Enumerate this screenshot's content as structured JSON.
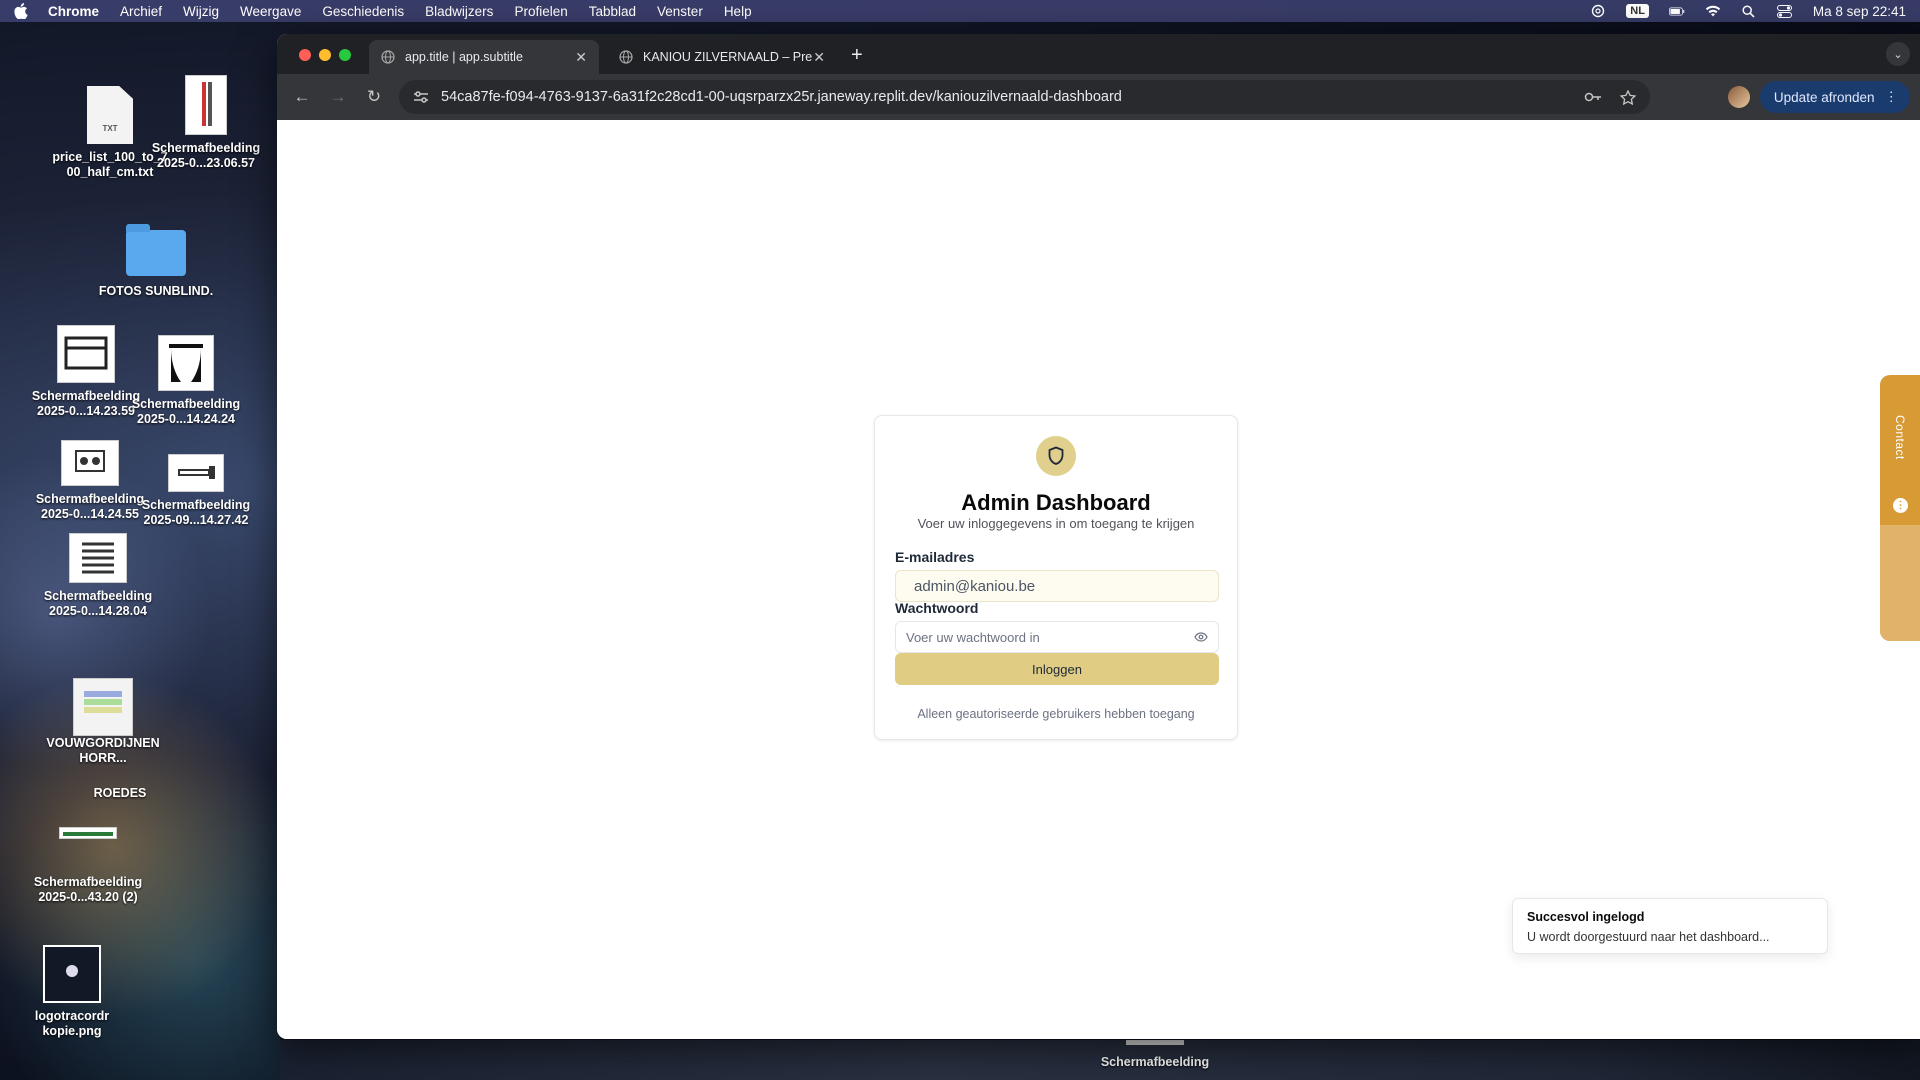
{
  "menubar": {
    "app_name": "Chrome",
    "items": [
      "Archief",
      "Wijzig",
      "Weergave",
      "Geschiedenis",
      "Bladwijzers",
      "Profielen",
      "Tabblad",
      "Venster",
      "Help"
    ],
    "input_source": "NL",
    "clock": "Ma 8 sep  22:41"
  },
  "desktop": {
    "icons": [
      {
        "label": "price_list_100_to_700_half_cm.txt",
        "badge": "TXT"
      },
      {
        "label": "Schermafbeelding 2025-0...23.06.57"
      },
      {
        "label": "FOTOS SUNBLIND."
      },
      {
        "label": "Schermafbeelding 2025-0...14.23.59"
      },
      {
        "label": "Schermafbeelding 2025-0...14.24.24"
      },
      {
        "label": "Schermafbeelding 2025-0...14.24.55"
      },
      {
        "label": "Schermafbeelding 2025-09...14.27.42"
      },
      {
        "label": "Schermafbeelding 2025-0...14.28.04"
      },
      {
        "label": "VOUWGORDIJNEN HORR..."
      },
      {
        "label": "ROEDES"
      },
      {
        "label": "Schermafbeelding 2025-0...43.20 (2)"
      },
      {
        "label": "logotracordr kopie.png"
      },
      {
        "label": "Schermafbeelding"
      }
    ]
  },
  "browser": {
    "tabs": [
      {
        "title": "app.title | app.subtitle",
        "active": true
      },
      {
        "title": "KANIOU ZILVERNAALD – Pre",
        "active": false
      }
    ],
    "url": "54ca87fe-f094-4763-9137-6a31f2c28cd1-00-uqsrparzx25r.janeway.replit.dev/kaniouzilvernaald-dashboard",
    "update_button": "Update afronden"
  },
  "login": {
    "title": "Admin Dashboard",
    "subtitle": "Voer uw inloggegevens in om toegang te krijgen",
    "email_label": "E-mailadres",
    "email_value": "admin@kaniou.be",
    "password_label": "Wachtwoord",
    "password_placeholder": "Voer uw wachtwoord in",
    "submit_label": "Inloggen",
    "note": "Alleen geautoriseerde gebruikers hebben toegang",
    "accent_color": "#e0cc82"
  },
  "contact_tab": {
    "label": "Contact",
    "color": "#d89a35"
  },
  "toast": {
    "title": "Succesvol ingelogd",
    "description": "U wordt doorgestuurd naar het dashboard..."
  }
}
